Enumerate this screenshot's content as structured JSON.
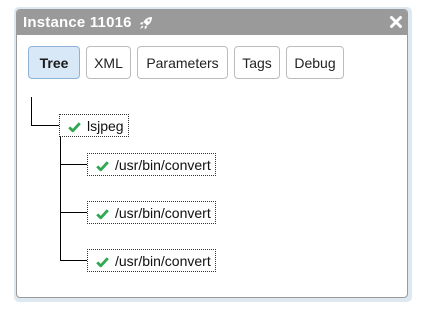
{
  "window": {
    "title": "Instance 11016",
    "title_icon": "rocket-icon",
    "close_icon": "close-icon"
  },
  "tabs": [
    {
      "label": "Tree",
      "active": true
    },
    {
      "label": "XML",
      "active": false
    },
    {
      "label": "Parameters",
      "active": false
    },
    {
      "label": "Tags",
      "active": false
    },
    {
      "label": "Debug",
      "active": false
    }
  ],
  "tree": {
    "root": {
      "label": "lsjpeg",
      "status": "check-icon"
    },
    "children": [
      {
        "label": "/usr/bin/convert",
        "status": "check-icon"
      },
      {
        "label": "/usr/bin/convert",
        "status": "check-icon"
      },
      {
        "label": "/usr/bin/convert",
        "status": "check-icon"
      }
    ]
  },
  "colors": {
    "titlebar": "#9a9a9a",
    "active_tab": "#d8e8f7",
    "check": "#2fa84f"
  }
}
